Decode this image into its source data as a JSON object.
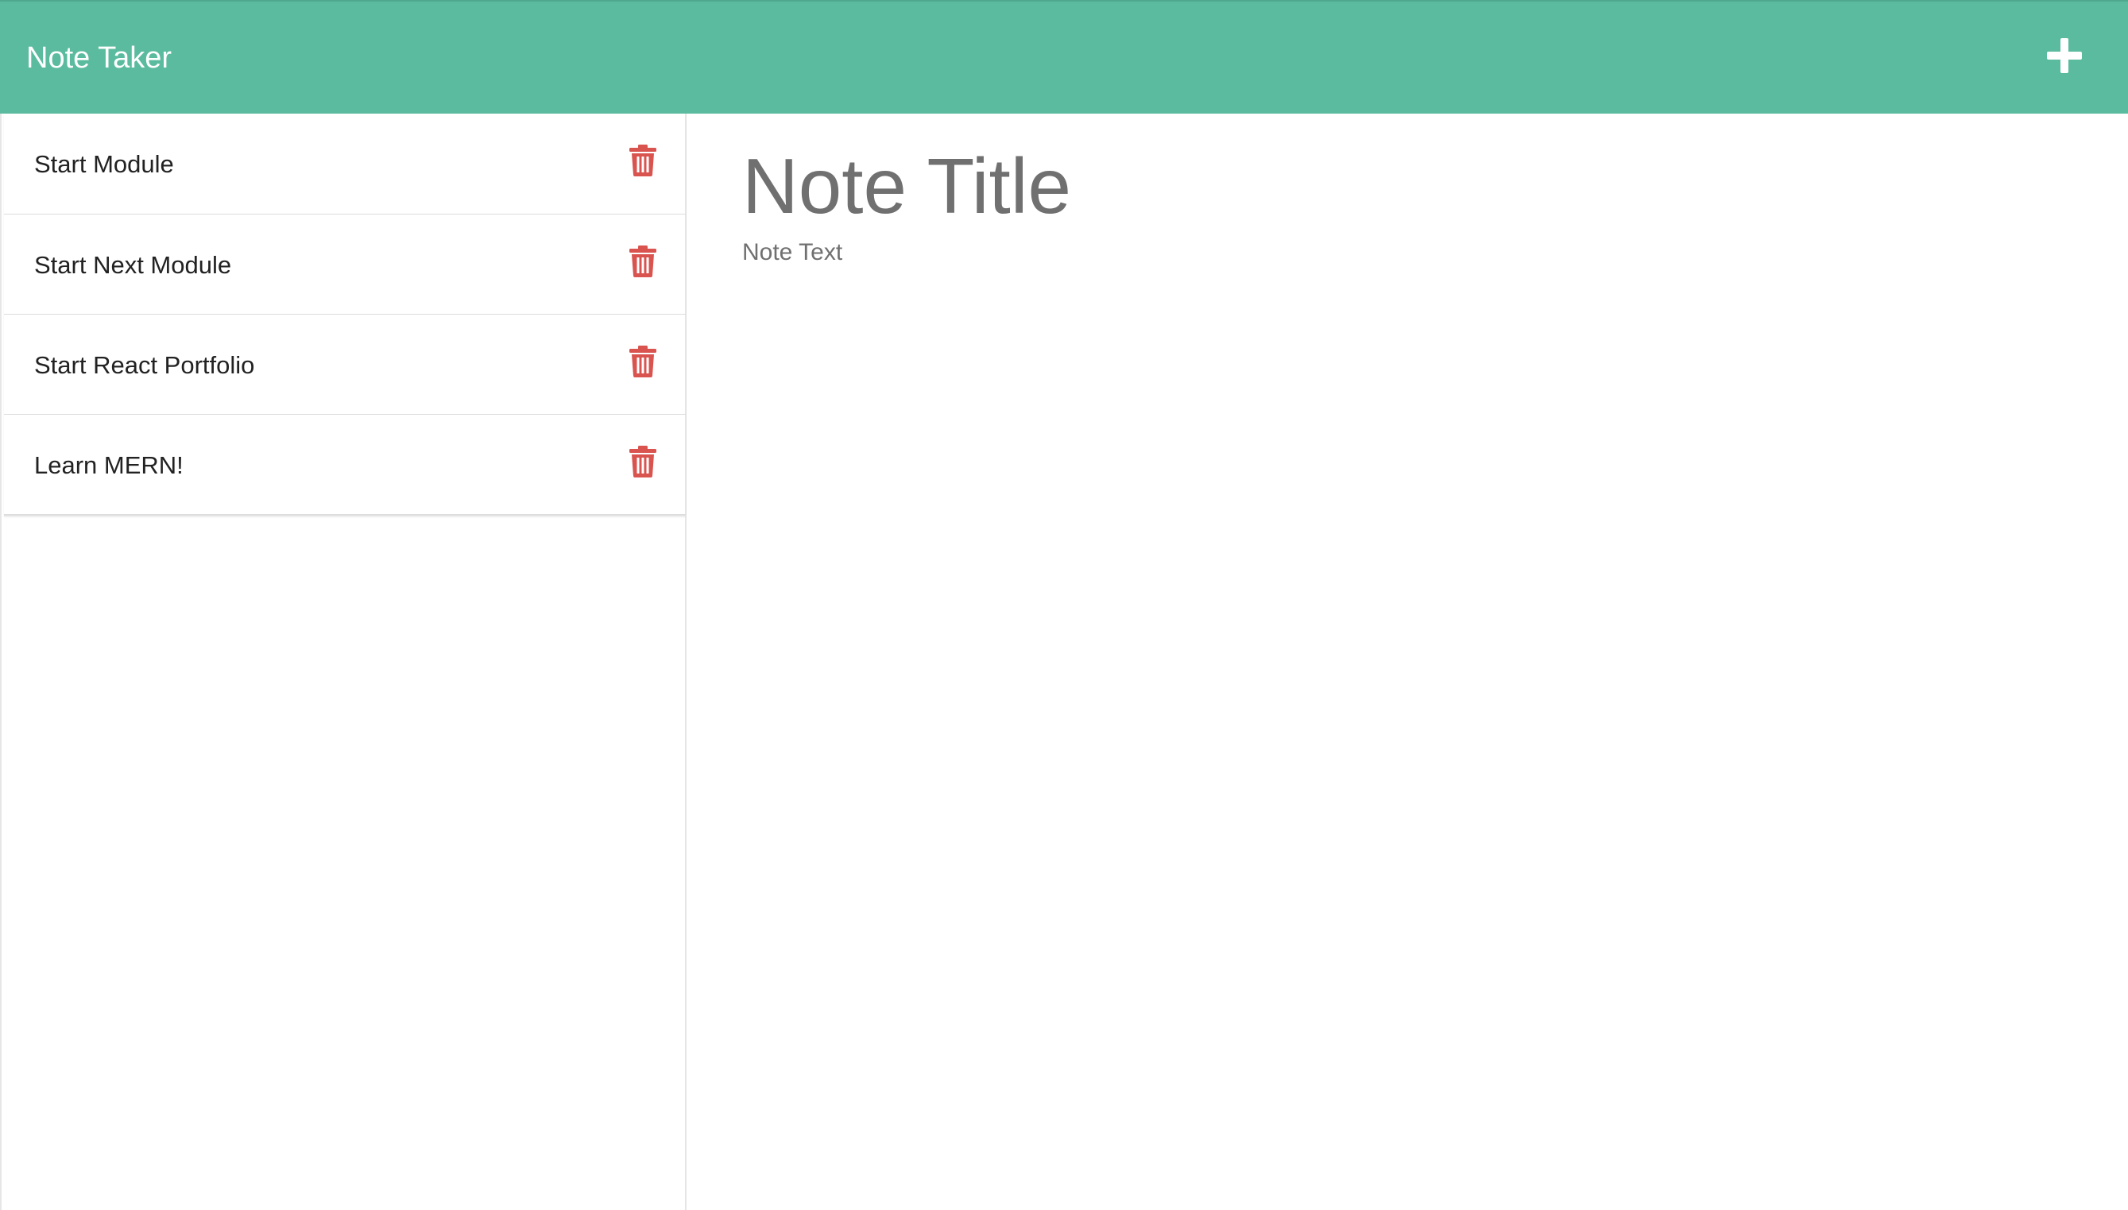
{
  "navbar": {
    "brand": "Note Taker",
    "new_note_icon": "plus-icon",
    "color": "#5bbb9e"
  },
  "notes": [
    {
      "title": "Start Module"
    },
    {
      "title": "Start Next Module"
    },
    {
      "title": "Start React Portfolio"
    },
    {
      "title": "Learn MERN!"
    }
  ],
  "delete_icon": "trash-icon",
  "delete_color": "#d9534f",
  "editor": {
    "title_placeholder": "Note Title",
    "text_placeholder": "Note Text"
  }
}
